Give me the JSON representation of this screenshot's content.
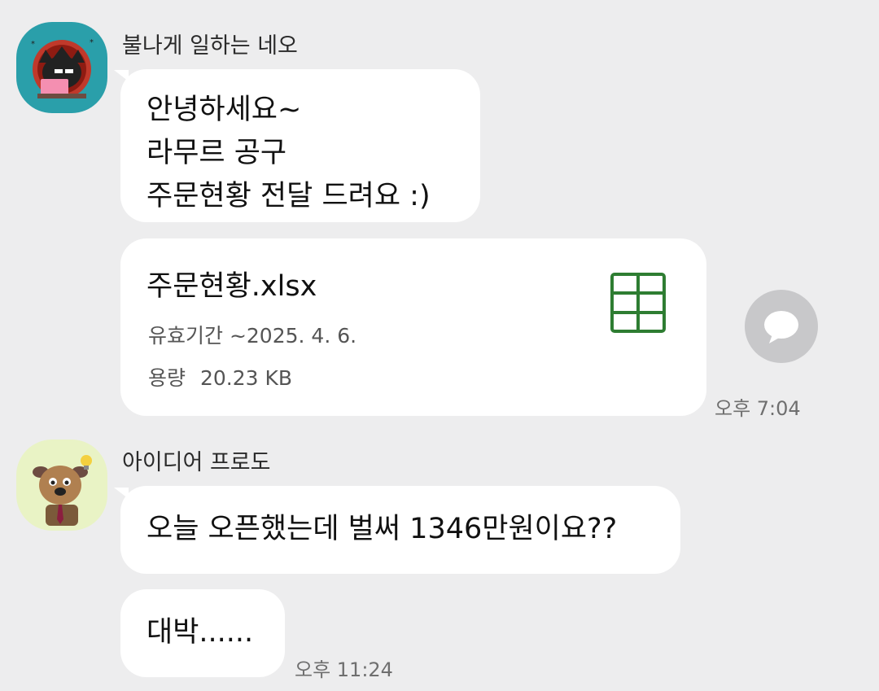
{
  "messages": [
    {
      "sender": "불나게 일하는 네오",
      "avatar_icon": "neo-character-avatar-icon",
      "text_lines": [
        "안녕하세요~",
        "라무르 공구",
        "주문현황 전달 드려요 :)"
      ],
      "file": {
        "name": "주문현황.xlsx",
        "expiry": "유효기간 ~2025. 4. 6.",
        "size_label": "용량",
        "size": "20.23 KB",
        "icon": "spreadsheet-icon",
        "icon_color": "#2e7d32"
      },
      "time": "오후 7:04"
    },
    {
      "sender": "아이디어 프로도",
      "avatar_icon": "frodo-character-avatar-icon",
      "texts": [
        "오늘 오픈했는데 벌써 1346만원이요??",
        "대박......"
      ],
      "time": "오후 11:24"
    }
  ],
  "share_button_icon": "chat-bubble-icon",
  "colors": {
    "background": "#ededee",
    "bubble": "#ffffff",
    "avatar1_bg": "#2a9faa",
    "avatar2_bg": "#e9f3c5"
  }
}
